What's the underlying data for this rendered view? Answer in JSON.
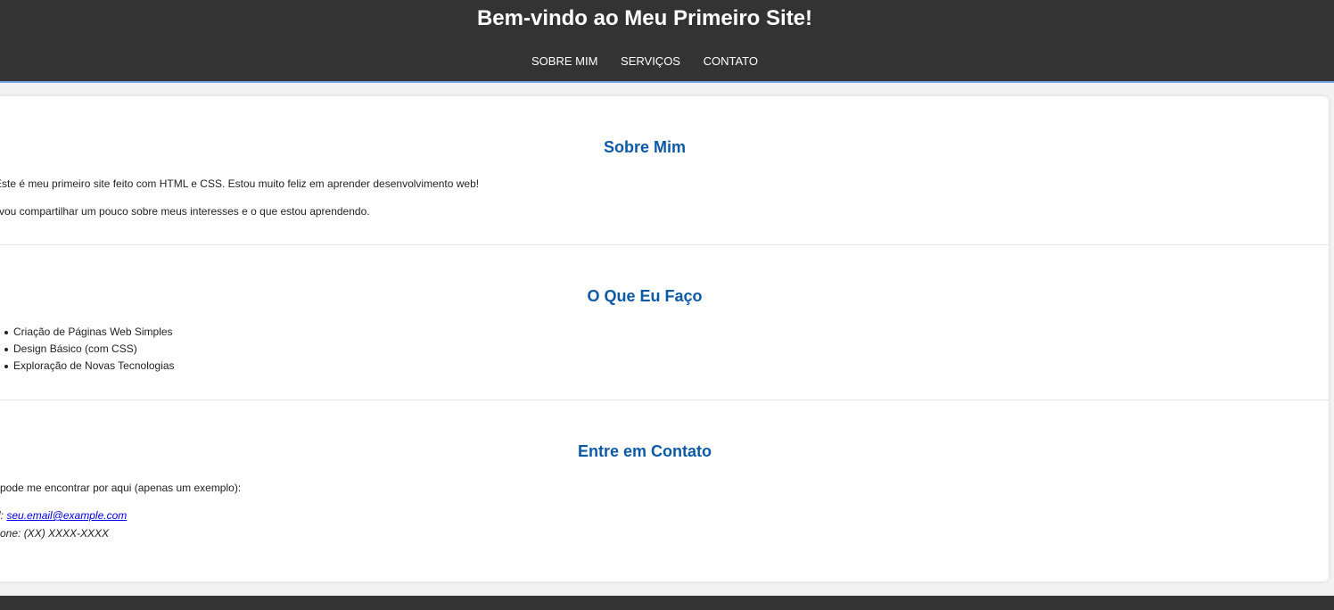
{
  "header": {
    "title": "Bem-vindo ao Meu Primeiro Site!",
    "nav": [
      {
        "label": "SOBRE MIM"
      },
      {
        "label": "SERVIÇOS"
      },
      {
        "label": "CONTATO"
      }
    ]
  },
  "about": {
    "heading": "Sobre Mim",
    "paragraphs": [
      "Este é meu primeiro site feito com HTML e CSS. Estou muito feliz em aprender desenvolvimento web!",
      "vou compartilhar um pouco sobre meus interesses e o que estou aprendendo."
    ]
  },
  "services": {
    "heading": "O Que Eu Faço",
    "items": [
      "Criação de Páginas Web Simples",
      "Design Básico (com CSS)",
      "Exploração de Novas Tecnologias"
    ]
  },
  "contact": {
    "heading": "Entre em Contato",
    "intro": "pode me encontrar por aqui (apenas um exemplo):",
    "email_prefix": "l: ",
    "email": "seu.email@example.com",
    "phone": "one: (XX) XXXX-XXXX"
  },
  "colors": {
    "header_bg": "#333333",
    "heading": "#0c5aa6",
    "link": "#0000ee",
    "accent_border": "#7ea7e8"
  }
}
